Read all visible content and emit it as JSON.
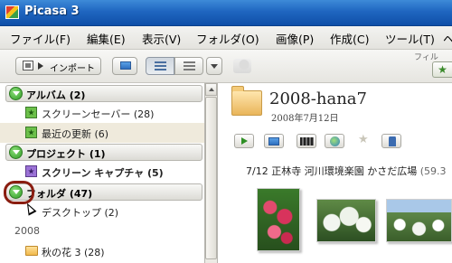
{
  "window": {
    "title": "Picasa 3"
  },
  "menu": [
    "ファイル(F)",
    "編集(E)",
    "表示(V)",
    "フォルダ(O)",
    "画像(P)",
    "作成(C)",
    "ツール(T)",
    "ヘ"
  ],
  "toolbar": {
    "import_label": "インポート",
    "filter_label": "フィル"
  },
  "sidebar": {
    "albums_header": "アルバム (2)",
    "albums": [
      {
        "label": "スクリーンセーバー (28)"
      },
      {
        "label": "最近の更新 (6)"
      }
    ],
    "projects_header": "プロジェクト (1)",
    "projects": [
      {
        "label": "スクリーン キャプチャ (5)"
      }
    ],
    "folders_header": "フォルダ (47)",
    "folders": [
      {
        "label": "デスクトップ (2)"
      }
    ],
    "year": "2008",
    "year_folders": [
      {
        "label": "秋の花 3 (28)"
      }
    ]
  },
  "album": {
    "title": "2008-hana7",
    "date": "2008年7月12日",
    "caption": "7/12 正林寺 河川環境楽園 かさだ広場",
    "caption_meta": "(59.3"
  },
  "colors": {
    "title_bar": "#1f66c0",
    "highlight_ring": "#8a1d10",
    "accent_green": "#2f9a25"
  }
}
